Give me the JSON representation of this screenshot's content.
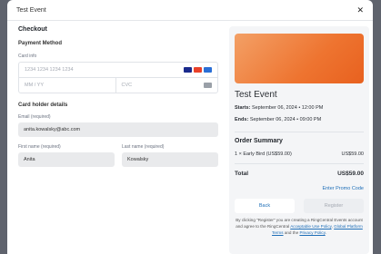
{
  "modal": {
    "title": "Test Event"
  },
  "checkout": {
    "heading": "Checkout",
    "payment_method": "Payment Method",
    "card_info_label": "Card info",
    "card_number_placeholder": "1234 1234 1234 1234",
    "expiry_placeholder": "MM / YY",
    "cvc_placeholder": "CVC",
    "card_holder_heading": "Card holder details",
    "email_label": "Email (required)",
    "email_value": "anita.kowalsky@abc.com",
    "first_name_label": "First name (required)",
    "first_name_value": "Anita",
    "last_name_label": "Last name (required)",
    "last_name_value": "Kowalsky"
  },
  "event": {
    "title": "Test Event",
    "starts_label": "Starts:",
    "starts_value": "September 06, 2024 • 12:00 PM",
    "ends_label": "Ends:",
    "ends_value": "September 06, 2024 • 09:00 PM"
  },
  "summary": {
    "title": "Order Summary",
    "item_label": "1 × Early Bird (US$59.00)",
    "item_price": "US$59.00",
    "total_label": "Total",
    "total_value": "US$59.00",
    "promo": "Enter Promo Code"
  },
  "buttons": {
    "back": "Back",
    "register": "Register"
  },
  "terms": {
    "pre": "By clicking \"Register\" you are creating a RingCentral Events account and agree to the RingCentral ",
    "aup": "Acceptable Use Policy",
    "mid": ", ",
    "gpt": "Global Platform Terms",
    "and": " and the ",
    "privacy": "Privacy Policy",
    "end": "."
  },
  "colors": {
    "accent": "#1f6fb8",
    "banner": "#ee7430"
  }
}
